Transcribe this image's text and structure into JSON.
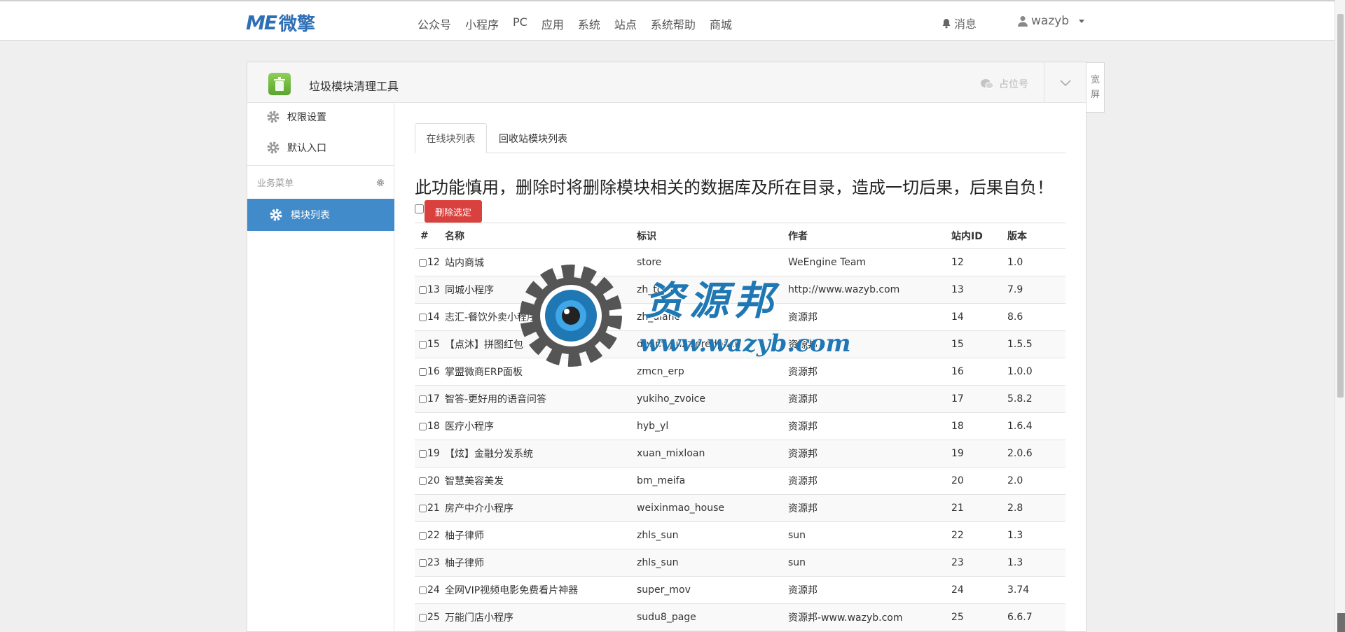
{
  "brand": {
    "mark": "ME",
    "name": "微擎"
  },
  "nav": [
    "公众号",
    "小程序",
    "PC",
    "应用",
    "系统",
    "站点",
    "系统帮助",
    "商城"
  ],
  "header_right": {
    "messages": "消息",
    "username": "wazyb"
  },
  "app": {
    "title": "垃圾模块清理工具",
    "account_label": "占位号",
    "wide_screen": "宽屏"
  },
  "sidebar": {
    "items": [
      {
        "label": "权限设置"
      },
      {
        "label": "默认入口"
      }
    ],
    "group_label": "业务菜单",
    "active_item": "模块列表"
  },
  "tabs": {
    "online": "在线块列表",
    "recycle": "回收站模块列表"
  },
  "warning": "此功能慎用，删除时将删除模块相关的数据库及所在目录，造成一切后果，后果自负！",
  "delete_button": "删除选定",
  "table": {
    "headers": [
      "#",
      "名称",
      "标识",
      "作者",
      "站内ID",
      "版本"
    ],
    "rows": [
      {
        "id": "12",
        "name": "站内商城",
        "ident": "store",
        "author": "WeEngine Team",
        "sid": "12",
        "ver": "1.0"
      },
      {
        "id": "13",
        "name": "同城小程序",
        "ident": "zh_tcwq",
        "author": "http://www.wazyb.com",
        "sid": "13",
        "ver": "7.9"
      },
      {
        "id": "14",
        "name": "志汇-餐饮外卖小程序",
        "ident": "zh_dianc",
        "author": "资源邦",
        "sid": "14",
        "ver": "8.6"
      },
      {
        "id": "15",
        "name": "【点沐】拼图红包",
        "ident": "deam_puzzleredpack",
        "author": "资源邦",
        "sid": "15",
        "ver": "1.5.5"
      },
      {
        "id": "16",
        "name": "掌盟微商ERP面板",
        "ident": "zmcn_erp",
        "author": "资源邦",
        "sid": "16",
        "ver": "1.0.0"
      },
      {
        "id": "17",
        "name": "智答-更好用的语音问答",
        "ident": "yukiho_zvoice",
        "author": "资源邦",
        "sid": "17",
        "ver": "5.8.2"
      },
      {
        "id": "18",
        "name": "医疗小程序",
        "ident": "hyb_yl",
        "author": "资源邦",
        "sid": "18",
        "ver": "1.6.4"
      },
      {
        "id": "19",
        "name": "【炫】金融分发系统",
        "ident": "xuan_mixloan",
        "author": "资源邦",
        "sid": "19",
        "ver": "2.0.6"
      },
      {
        "id": "20",
        "name": "智慧美容美发",
        "ident": "bm_meifa",
        "author": "资源邦",
        "sid": "20",
        "ver": "2.0"
      },
      {
        "id": "21",
        "name": "房产中介小程序",
        "ident": "weixinmao_house",
        "author": "资源邦",
        "sid": "21",
        "ver": "2.8"
      },
      {
        "id": "22",
        "name": "柚子律师",
        "ident": "zhls_sun",
        "author": "sun",
        "sid": "22",
        "ver": "1.3"
      },
      {
        "id": "23",
        "name": "柚子律师",
        "ident": "zhls_sun",
        "author": "sun",
        "sid": "23",
        "ver": "1.3"
      },
      {
        "id": "24",
        "name": "全网VIP视频电影免费看片神器",
        "ident": "super_mov",
        "author": "资源邦",
        "sid": "24",
        "ver": "3.74"
      },
      {
        "id": "25",
        "name": "万能门店小程序",
        "ident": "sudu8_page",
        "author": "资源邦-www.wazyb.com",
        "sid": "25",
        "ver": "6.6.7"
      }
    ]
  },
  "watermark": {
    "text": "资源邦",
    "url": "www.wazyb.com"
  },
  "colors": {
    "brand": "#2f6fb5",
    "active": "#428bca",
    "danger": "#d9413e"
  }
}
